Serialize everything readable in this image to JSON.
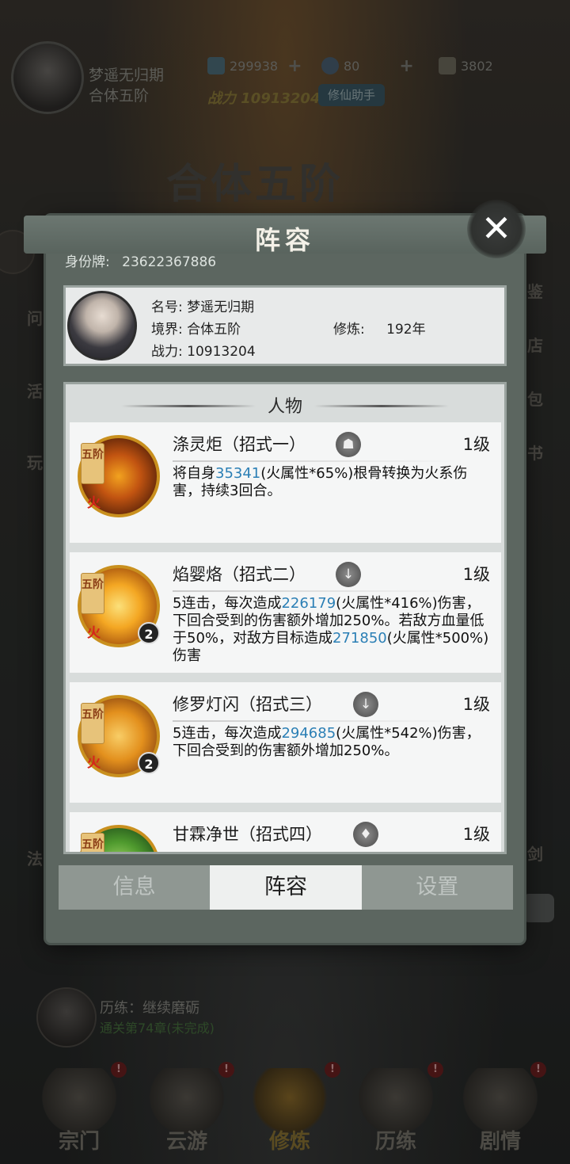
{
  "player": {
    "name": "梦遥无归期",
    "realm": "合体五阶",
    "power_label": "战力",
    "power": "10913204",
    "id_label": "身份牌:",
    "id": "23622367886"
  },
  "resources": [
    {
      "icon": "spirit-stone-icon",
      "value": "299938"
    },
    {
      "icon": "spirit-essence-icon",
      "value": "80"
    },
    {
      "icon": "scroll-icon",
      "value": "3802"
    }
  ],
  "header": {
    "helper_label": "修仙助手",
    "realm_banner": "合体五阶"
  },
  "side_labels": {
    "left": [
      "问",
      "活",
      "玩",
      "法"
    ],
    "right": [
      "鉴",
      "店",
      "包",
      "书",
      "剑"
    ]
  },
  "training": {
    "title": "历练：继续磨砺",
    "progress": "通关第74章(未完成)"
  },
  "bottom_nav": [
    {
      "label": "宗门",
      "alert": "!"
    },
    {
      "label": "云游",
      "alert": "!"
    },
    {
      "label": "修炼",
      "alert": "!"
    },
    {
      "label": "历练",
      "alert": "!"
    },
    {
      "label": "剧情",
      "alert": "!"
    }
  ],
  "modal": {
    "title": "阵容",
    "close_icon": "close-icon",
    "profile": {
      "name_label": "名号:",
      "name": "梦遥无归期",
      "realm_label": "境界:",
      "realm": "合体五阶",
      "cultivation_label": "修炼:",
      "cultivation": "192年",
      "power_label": "战力:",
      "power": "10913204"
    },
    "section_title": "人物",
    "skills": [
      {
        "name": "涤灵炬（招式一）",
        "level": "1级",
        "tier": "五阶",
        "element": "火",
        "count": "",
        "desc_parts": [
          {
            "text": "将自身",
            "num": false
          },
          {
            "text": "35341",
            "num": true
          },
          {
            "text": "(火属性*65%)根骨转换为火系伤害，持续3回合。",
            "num": false
          }
        ]
      },
      {
        "name": "焰婴烙（招式二）",
        "level": "1级",
        "tier": "五阶",
        "element": "火",
        "count": "2",
        "desc_parts": [
          {
            "text": "5连击，每次造成",
            "num": false
          },
          {
            "text": "226179",
            "num": true
          },
          {
            "text": "(火属性*416%)伤害，下回合受到的伤害额外增加250%。若敌方血量低于50%，对敌方目标造成",
            "num": false
          },
          {
            "text": "271850",
            "num": true
          },
          {
            "text": "(火属性*500%)伤害",
            "num": false
          }
        ]
      },
      {
        "name": "修罗灯闪（招式三）",
        "level": "1级",
        "tier": "五阶",
        "element": "火",
        "count": "2",
        "desc_parts": [
          {
            "text": "5连击，每次造成",
            "num": false
          },
          {
            "text": "294685",
            "num": true
          },
          {
            "text": "(火属性*542%)伤害，下回合受到的伤害额外增加250%。",
            "num": false
          }
        ]
      },
      {
        "name": "甘霖净世（招式四）",
        "level": "1级",
        "tier": "五阶",
        "element": "",
        "count": "",
        "desc_parts": []
      }
    ],
    "tabs": [
      {
        "label": "信息",
        "active": false
      },
      {
        "label": "阵容",
        "active": true
      },
      {
        "label": "设置",
        "active": false
      }
    ]
  }
}
